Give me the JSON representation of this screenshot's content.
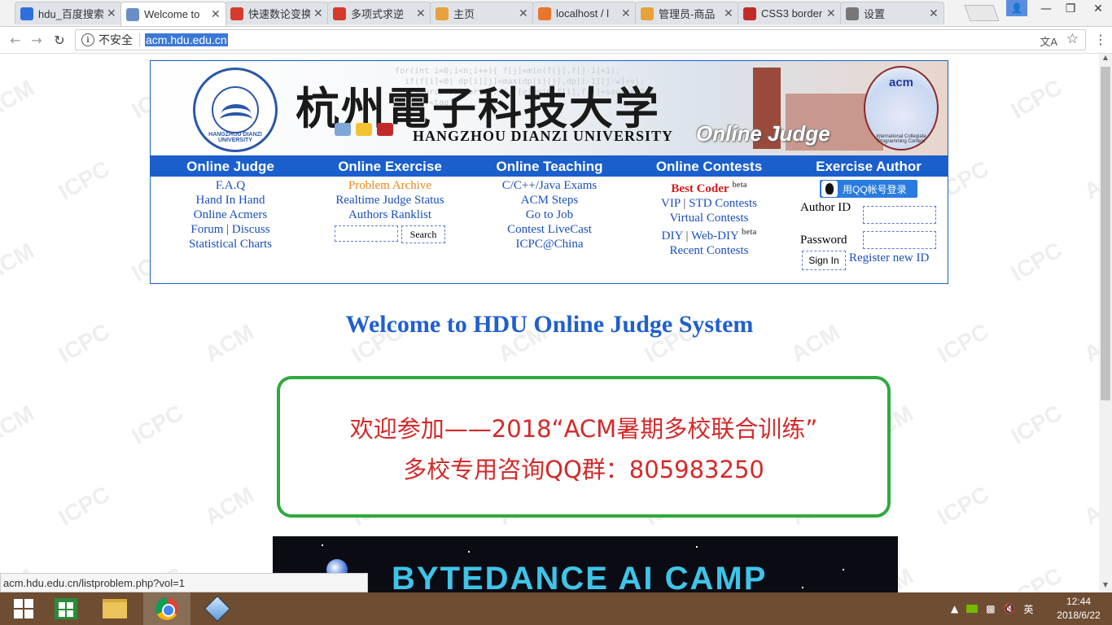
{
  "browser": {
    "tabs": [
      {
        "title": "hdu_百度搜索",
        "favicon": "baidu-paw",
        "color": "#2f6fdc",
        "active": false
      },
      {
        "title": "Welcome to",
        "favicon": "hdu-logo",
        "color": "#6a8fc8",
        "active": true
      },
      {
        "title": "快速数论变换",
        "favicon": "csdn-c",
        "color": "#d63a2a",
        "active": false
      },
      {
        "title": "多项式求逆",
        "favicon": "csdn-c",
        "color": "#d63a2a",
        "active": false
      },
      {
        "title": "主页",
        "favicon": "smiley",
        "color": "#e6a23c",
        "active": false
      },
      {
        "title": "localhost / l",
        "favicon": "phpmyadmin",
        "color": "#e8752a",
        "active": false
      },
      {
        "title": "管理员-商品",
        "favicon": "smiley",
        "color": "#e6a23c",
        "active": false
      },
      {
        "title": "CSS3 border",
        "favicon": "runoob-c",
        "color": "#c22a2a",
        "active": false
      },
      {
        "title": "设置",
        "favicon": "gear",
        "color": "#777777",
        "active": false
      }
    ],
    "security_label": "不安全",
    "url": "acm.hdu.edu.cn",
    "status_url": "acm.hdu.edu.cn/listproblem.php?vol=1"
  },
  "header": {
    "university_cn": "杭州電子科技大学",
    "university_en": "HANGZHOU DIANZI UNIVERSITY",
    "oj_title": "Online Judge",
    "seal_text": "HANGZHOU DIANZI UNIVERSITY",
    "acm_logo_text": "acm",
    "acm_logo_sub": "International Collegiate Programming Contest",
    "code_bg": "for(int i=0;i<n;i++){ f[j]=min(f[j],f[j-1]+1);\n  if(f[i]<0) dp[i][j]=max(dp[i][j],dp[i-1][j-w]+v);\n    source:2) for(...){ f[n]=min(f[i],f[j]+source.2);\n  if (f<tag)"
  },
  "nav": {
    "online_judge": {
      "title": "Online Judge",
      "links": [
        "F.A.Q",
        "Hand In Hand",
        "Online Acmers"
      ],
      "forum": "Forum",
      "discuss": "Discuss",
      "charts": "Statistical Charts"
    },
    "online_exercise": {
      "title": "Online Exercise",
      "problem_archive": "Problem Archive",
      "realtime_status": "Realtime Judge Status",
      "authors_ranklist": "Authors Ranklist",
      "search_button": "Search"
    },
    "online_teaching": {
      "title": "Online Teaching",
      "links": [
        "C/C++/Java Exams",
        "ACM Steps",
        "Go to Job",
        "Contest LiveCast",
        "ICPC@China"
      ]
    },
    "online_contests": {
      "title": "Online Contests",
      "best_coder": "Best Coder",
      "beta": "beta",
      "vip": "VIP",
      "std": "STD Contests",
      "virtual": "Virtual Contests",
      "diy": "DIY",
      "web_diy": "Web-DIY",
      "recent": "Recent Contests"
    },
    "exercise_author": {
      "title": "Exercise Author",
      "qq_login": "用QQ帐号登录",
      "author_id_label": "Author ID",
      "password_label": "Password",
      "sign_in": "Sign In",
      "register": "Register new ID"
    }
  },
  "welcome": "Welcome to HDU Online Judge System",
  "notice": {
    "line1": "欢迎参加——2018“ACM暑期多校联合训练”",
    "line2": "多校专用咨询QQ群：805983250"
  },
  "promo": {
    "text": "BYTEDANCE AI CAMP"
  },
  "watermark": [
    "ACM",
    "ICPC"
  ],
  "taskbar": {
    "ime": "英",
    "time": "12:44",
    "date": "2018/6/22"
  }
}
